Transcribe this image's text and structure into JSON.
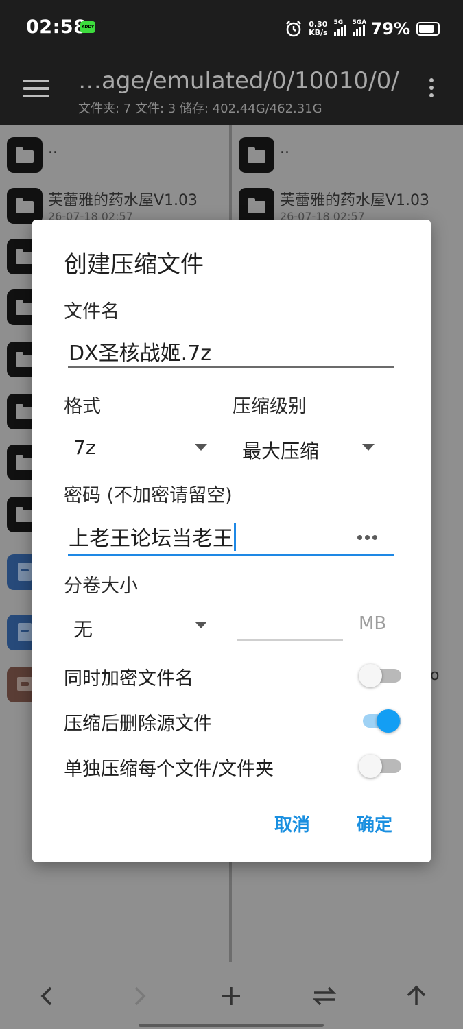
{
  "status": {
    "time": "02:58",
    "badge": "KDDY",
    "net_speed_value": "0.30",
    "net_speed_unit": "KB/s",
    "sim1_tag": "5G",
    "sim2_tag": "5GA",
    "battery_percent": "79%",
    "battery_level": 0.79
  },
  "appbar": {
    "path": "…age/emulated/0/10010/0/",
    "info": "文件夹: 7  文件: 3  储存: 402.44G/462.31G"
  },
  "panes": {
    "left": {
      "parent": "..",
      "first_item_name": "芙蕾雅的药水屋V1.03",
      "first_item_date": "26-07-18 02:57"
    },
    "right": {
      "parent": "..",
      "first_item_name": "芙蕾雅的药水屋V1.03",
      "first_item_date": "26-07-18 02:57",
      "partial_text": "o"
    }
  },
  "dialog": {
    "title": "创建压缩文件",
    "filename_label": "文件名",
    "filename_value": "DX圣核战姬.7z",
    "format_label": "格式",
    "format_value": "7z",
    "level_label": "压缩级别",
    "level_value": "最大压缩",
    "password_label": "密码 (不加密请留空)",
    "password_value": "上老王论坛当老王",
    "split_label": "分卷大小",
    "split_value": "无",
    "split_unit": "MB",
    "switches": [
      {
        "label": "同时加密文件名",
        "on": false
      },
      {
        "label": "压缩后删除源文件",
        "on": true
      },
      {
        "label": "单独压缩每个文件/文件夹",
        "on": false
      }
    ],
    "cancel_label": "取消",
    "confirm_label": "确定"
  },
  "bottom_nav": {
    "back_icon": "chevron-left",
    "forward_icon": "chevron-right",
    "add_icon": "plus",
    "swap_icon": "swap-arrows",
    "up_icon": "arrow-up"
  },
  "colors": {
    "accent": "#139ef4",
    "button_text": "#1a8fe0",
    "cursor": "#1e88e5"
  }
}
